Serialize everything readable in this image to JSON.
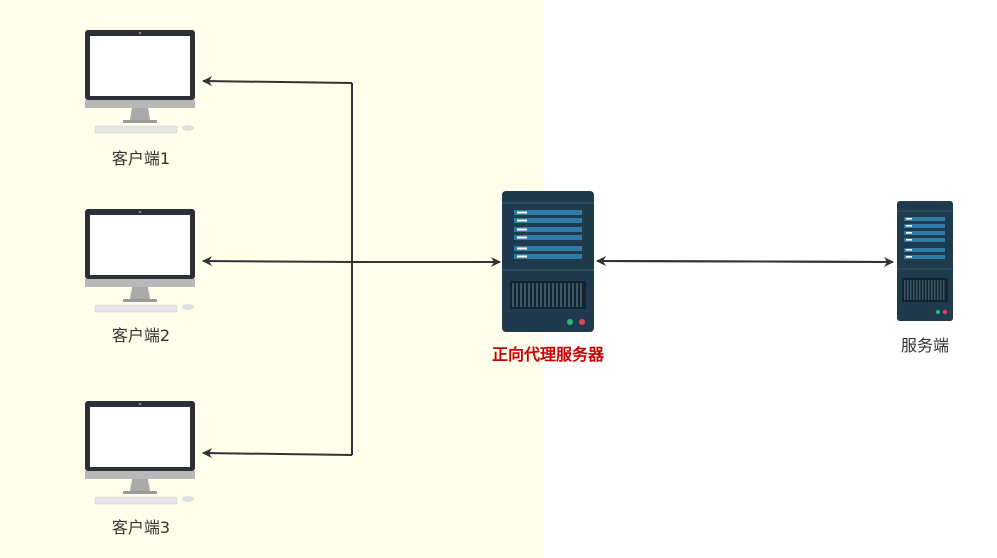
{
  "diagram": {
    "clients": [
      {
        "label": "客户端1"
      },
      {
        "label": "客户端2"
      },
      {
        "label": "客户端3"
      }
    ],
    "proxy": {
      "label": "正向代理服务器"
    },
    "server": {
      "label": "服务端"
    }
  },
  "colors": {
    "client_zone": "#FFFFEC",
    "proxy_label": "#CC0000",
    "server_label": "#333333",
    "client_label": "#333333",
    "line": "#333333",
    "server_body": "#203A4D",
    "server_stripe": "#2E7BA8",
    "server_led_green": "#28B57A",
    "server_led_red": "#E0445A",
    "monitor_bezel": "#2C2F36",
    "monitor_stand": "#A9A9A9"
  },
  "icons": {
    "client": "desktop-computer-icon",
    "proxy": "server-rack-icon",
    "server": "server-rack-icon"
  }
}
